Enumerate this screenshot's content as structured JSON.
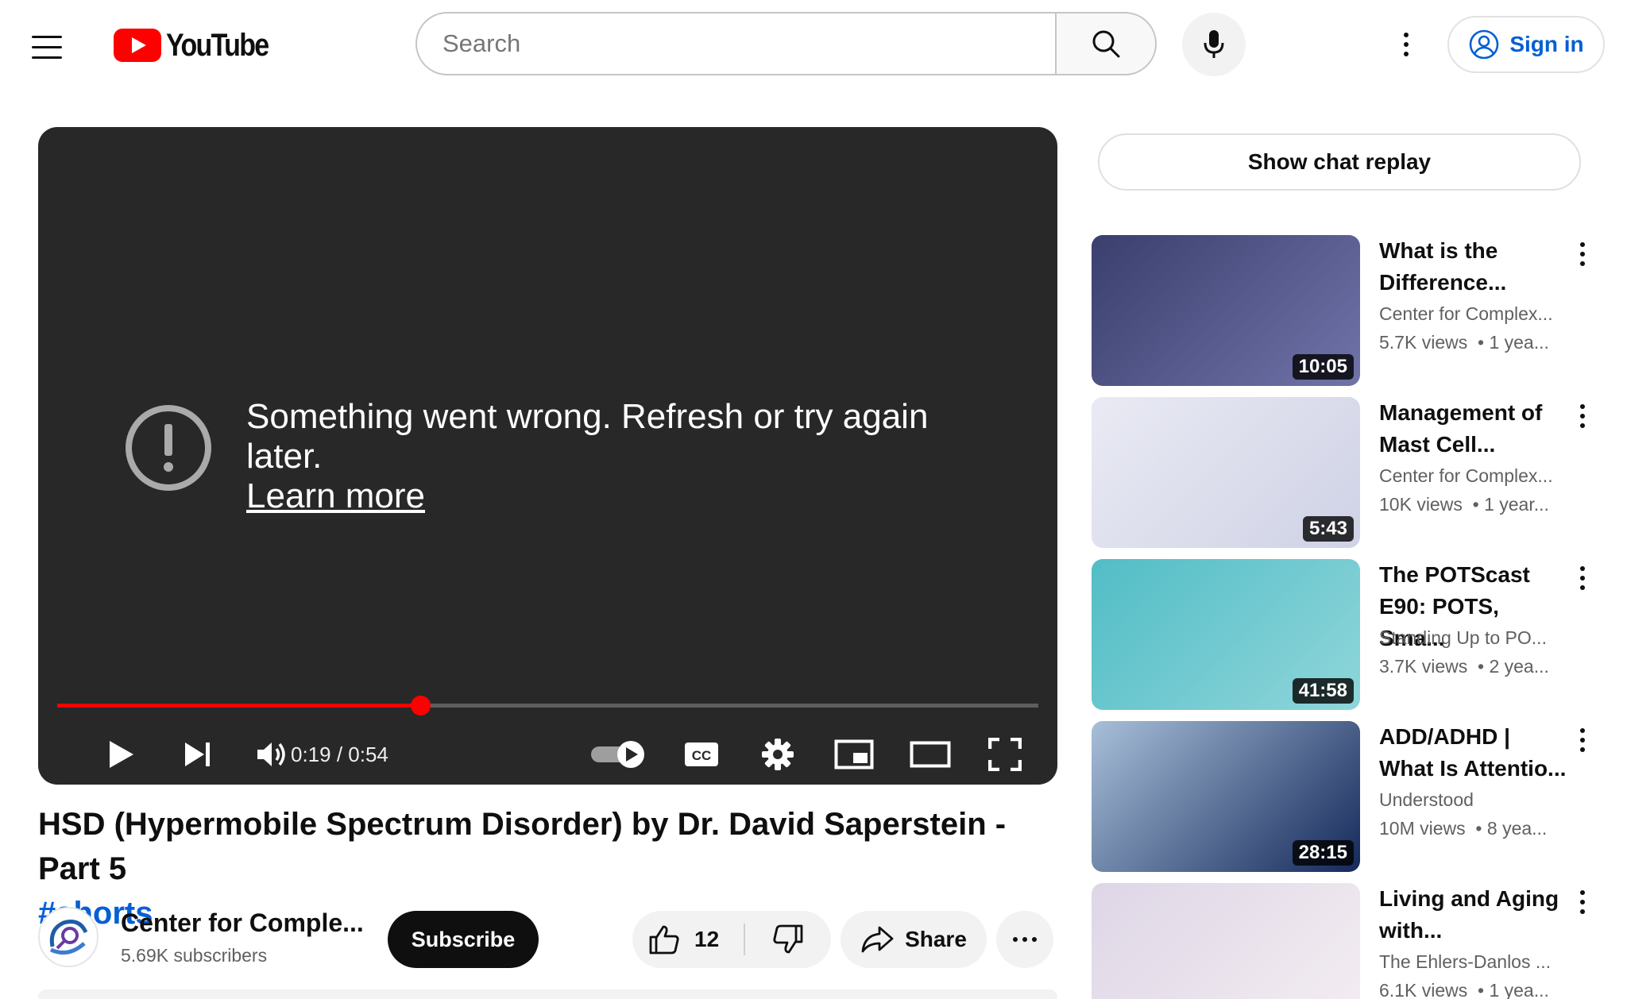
{
  "header": {
    "logo_text": "YouTube",
    "search_placeholder": "Search",
    "sign_in_label": "Sign in"
  },
  "player": {
    "error_message": "Something went wrong. Refresh or try again later.",
    "learn_more": "Learn more",
    "time_current": "0:19",
    "time_separator": " / ",
    "time_total": "0:54",
    "progress": 0.37,
    "autoplay": true,
    "control_icons": [
      "play-icon",
      "next-icon",
      "volume-icon",
      "autoplay-toggle-icon",
      "captions-icon",
      "settings-icon",
      "miniplayer-icon",
      "theater-mode-icon",
      "fullscreen-icon"
    ],
    "colors": {
      "background": "#282828",
      "progress": "#ff0000"
    }
  },
  "video": {
    "title": "HSD (Hypermobile Spectrum Disorder) by Dr. David Saperstein - Part 5",
    "hashtag": "#shorts",
    "channel_name": "Center for Comple...",
    "subscribers": "5.69K subscribers",
    "subscribe_label": "Subscribe",
    "likes": "12",
    "share_label": "Share"
  },
  "sidebar": {
    "chat_replay_label": "Show chat replay",
    "recommendations": [
      {
        "title": "What is the\nDifference...",
        "channel": "Center for Complex...",
        "views": "5.7K views",
        "age": "1 yea...",
        "duration": "10:05",
        "thumb_colors": [
          "#3b3f6e",
          "#6f73a8"
        ]
      },
      {
        "title": "Management of\nMast Cell...",
        "channel": "Center for Complex...",
        "views": "10K views",
        "age": "1 year...",
        "duration": "5:43",
        "thumb_colors": [
          "#e9eaf3",
          "#cfd2e6"
        ]
      },
      {
        "title": "The POTScast\nE90: POTS, Sma...",
        "channel": "Standing Up to PO...",
        "views": "3.7K views",
        "age": "2 yea...",
        "duration": "41:58",
        "thumb_colors": [
          "#52bdc6",
          "#8fd6da"
        ]
      },
      {
        "title": "ADD/ADHD |\nWhat Is Attentio...",
        "channel": "Understood",
        "views": "10M views",
        "age": "8 yea...",
        "duration": "28:15",
        "thumb_colors": [
          "#a8bfd9",
          "#14295a"
        ]
      },
      {
        "title": "Living and Aging\nwith...",
        "channel": "The Ehlers-Danlos ...",
        "views": "6.1K views",
        "age": "1 yea...",
        "duration": "",
        "thumb_colors": [
          "#ded6e6",
          "#f4eef2"
        ]
      }
    ]
  }
}
